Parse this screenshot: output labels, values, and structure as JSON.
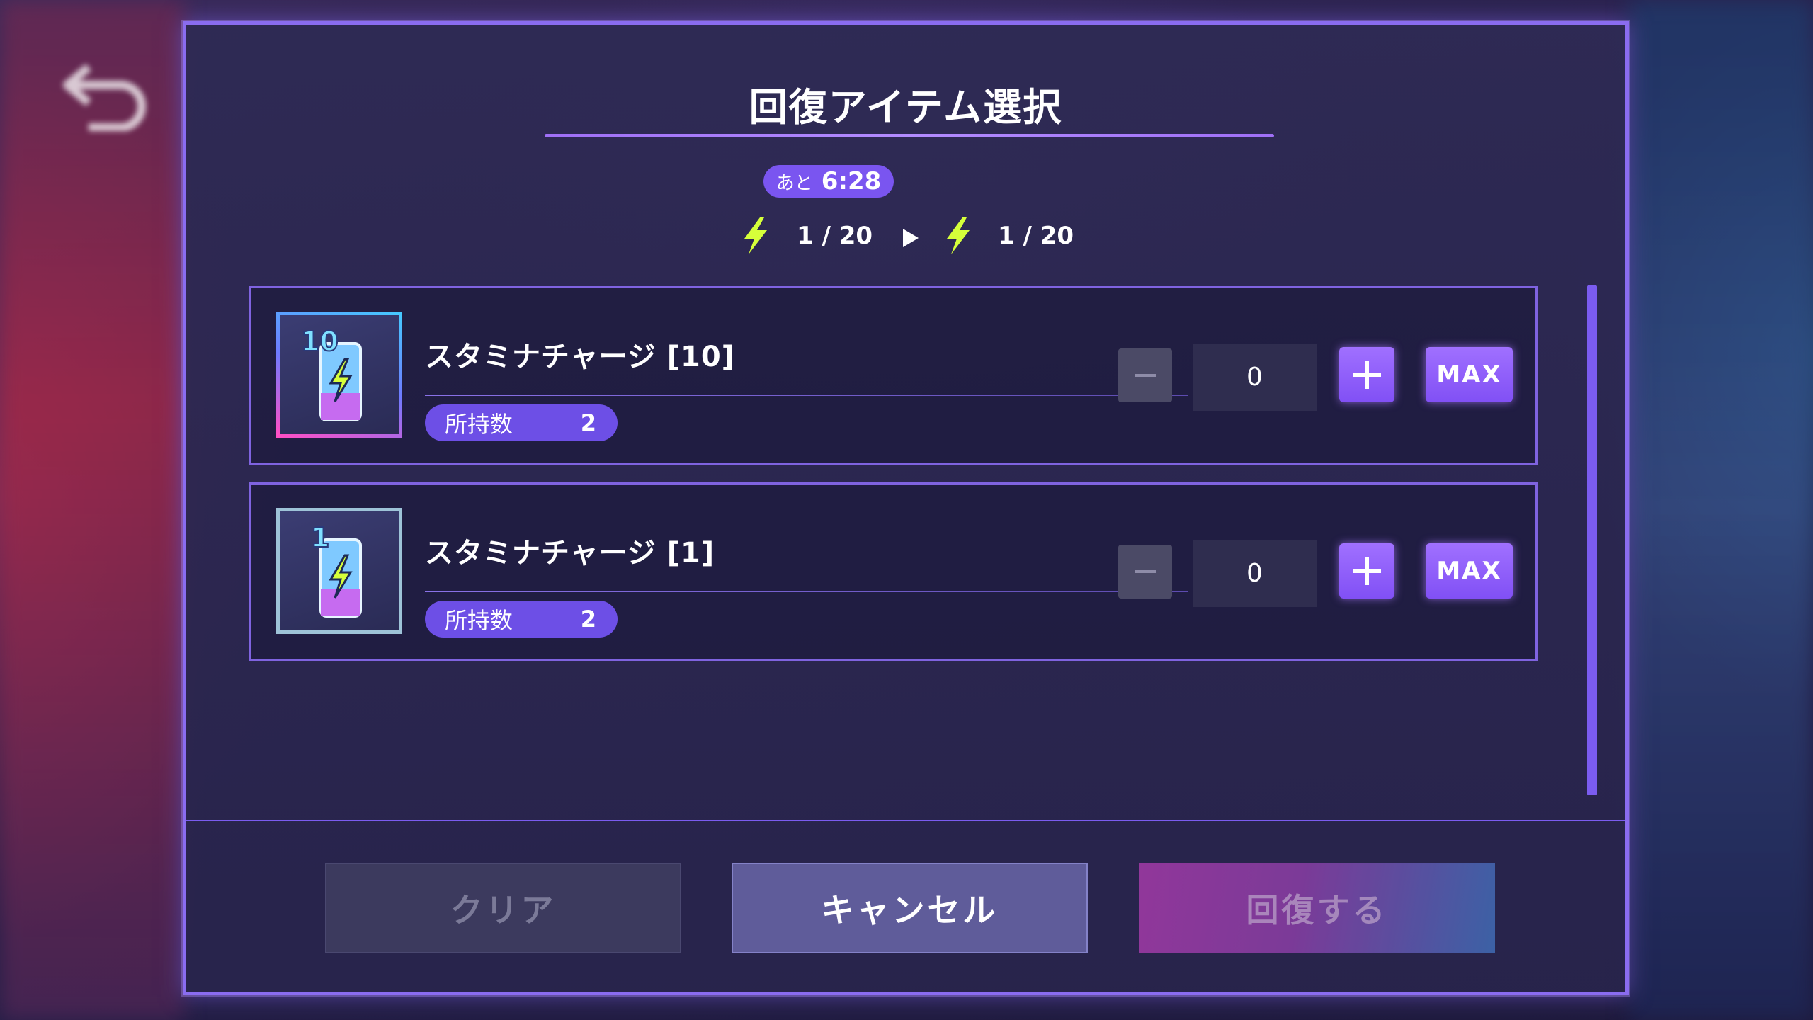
{
  "dialog": {
    "title": "回復アイテム選択",
    "timer": {
      "label": "あと",
      "value": "6:28"
    },
    "stamina": {
      "current": "1 / 20",
      "after": "1 / 20"
    }
  },
  "items": [
    {
      "name": "スタミナチャージ [10]",
      "owned_label": "所持数",
      "owned_value": "2",
      "quantity": "0",
      "max_label": "MAX",
      "icon_number": "10"
    },
    {
      "name": "スタミナチャージ [1]",
      "owned_label": "所持数",
      "owned_value": "2",
      "quantity": "0",
      "max_label": "MAX",
      "icon_number": "1"
    }
  ],
  "footer": {
    "clear_label": "クリア",
    "cancel_label": "キャンセル",
    "recover_label": "回復する"
  },
  "colors": {
    "accent": "#7b5cf0",
    "bolt": "#d6ff3a",
    "modal_border": "#8a6cf0"
  }
}
